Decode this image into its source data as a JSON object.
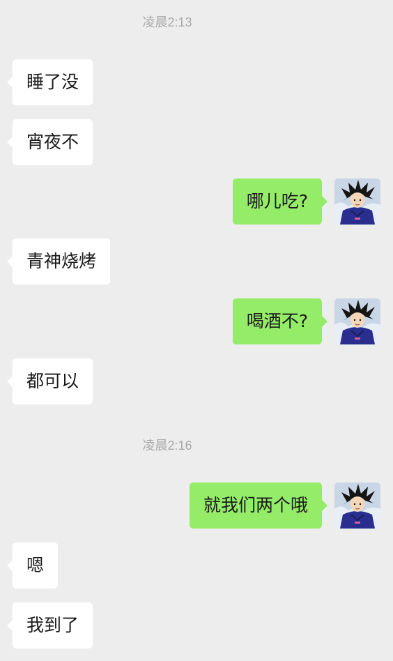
{
  "timestamps": [
    "凌晨2:13",
    "凌晨2:16"
  ],
  "messages": [
    {
      "side": "left",
      "text": "睡了没"
    },
    {
      "side": "left",
      "text": "宵夜不"
    },
    {
      "side": "right",
      "text": "哪儿吃?"
    },
    {
      "side": "left",
      "text": "青神烧烤"
    },
    {
      "side": "right",
      "text": "喝酒不?"
    },
    {
      "side": "left",
      "text": "都可以"
    },
    {
      "side": "right",
      "text": "就我们两个哦"
    },
    {
      "side": "left",
      "text": "嗯"
    },
    {
      "side": "left",
      "text": "我到了"
    }
  ],
  "colors": {
    "background": "#ededed",
    "incoming_bubble": "#ffffff",
    "outgoing_bubble": "#95ec69",
    "timestamp_text": "#a9a9a9"
  },
  "avatar_icon": "anime-character-avatar-icon"
}
